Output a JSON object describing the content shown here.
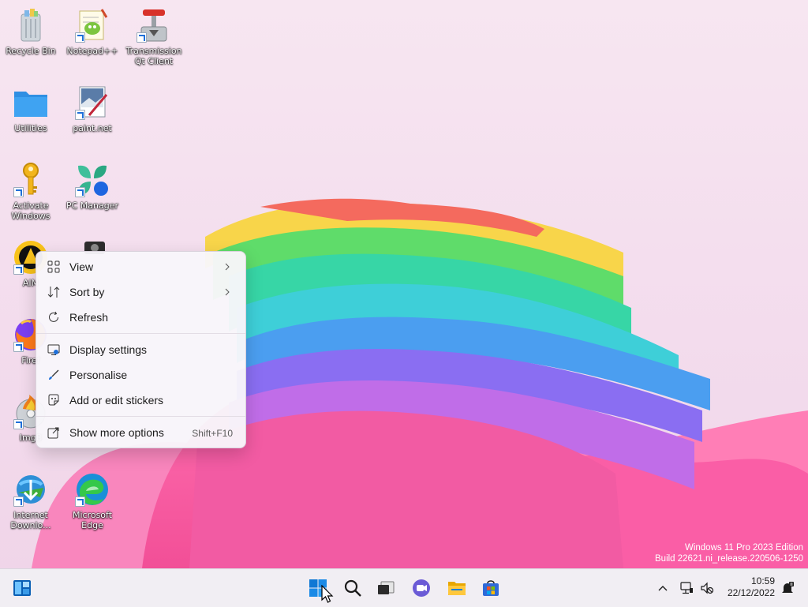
{
  "desktop": {
    "icons": [
      {
        "label": "Recycle Bin"
      },
      {
        "label": "Notepad++"
      },
      {
        "label": "Transmission Qt Client"
      },
      {
        "label": "Utilities"
      },
      {
        "label": "paint.net"
      },
      {
        "label": "Activate Windows"
      },
      {
        "label": "PC Manager"
      },
      {
        "label": "AIM"
      },
      {
        "label": "Firef"
      },
      {
        "label": "ImgB"
      },
      {
        "label": "Internet Downlo..."
      },
      {
        "label": "Microsoft Edge"
      }
    ]
  },
  "context_menu": {
    "items": [
      {
        "label": "View",
        "icon": "grid-icon",
        "submenu": true
      },
      {
        "label": "Sort by",
        "icon": "sort-icon",
        "submenu": true
      },
      {
        "label": "Refresh",
        "icon": "refresh-icon"
      },
      {
        "label": "Display settings",
        "icon": "display-icon"
      },
      {
        "label": "Personalise",
        "icon": "brush-icon"
      },
      {
        "label": "Add or edit stickers",
        "icon": "sticker-icon"
      },
      {
        "label": "Show more options",
        "icon": "share-icon",
        "shortcut": "Shift+F10"
      }
    ]
  },
  "watermark": {
    "line1": "Windows 11 Pro 2023 Edition",
    "line2": "Build 22621.ni_release.220506-1250"
  },
  "taskbar": {
    "time": "10:59",
    "date": "22/12/2022",
    "apps": [
      "widgets-icon",
      "start-icon",
      "search-icon",
      "task-view-icon",
      "chat-icon",
      "file-explorer-icon",
      "store-icon"
    ]
  },
  "colors": {
    "accent": "#0067c0",
    "menu_bg": "#f8f6fa",
    "taskbar_bg": "#f1eef3"
  }
}
